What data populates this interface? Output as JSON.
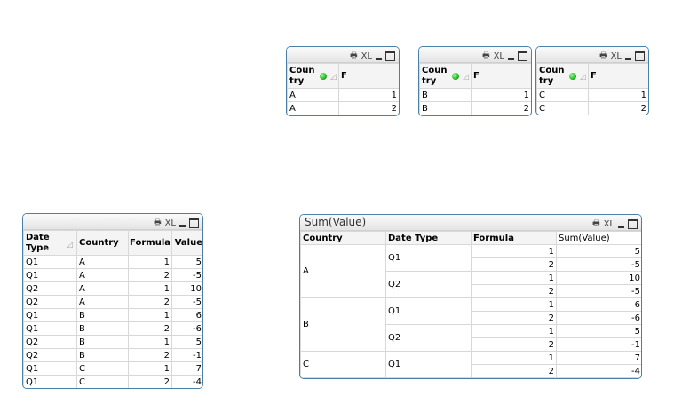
{
  "caption_icons": {
    "print": "print-icon",
    "xl": "XL",
    "minimize": "minimize-icon",
    "maximize": "maximize-icon"
  },
  "list_boxes": [
    {
      "header": [
        "Coun try",
        "F"
      ],
      "rows": [
        [
          "A",
          "1"
        ],
        [
          "A",
          "2"
        ]
      ]
    },
    {
      "header": [
        "Coun try",
        "F"
      ],
      "rows": [
        [
          "B",
          "1"
        ],
        [
          "B",
          "2"
        ]
      ]
    },
    {
      "header": [
        "Coun try",
        "F"
      ],
      "rows": [
        [
          "C",
          "1"
        ],
        [
          "C",
          "2"
        ]
      ]
    }
  ],
  "straight_table": {
    "header": [
      "Date Type",
      "Country",
      "Formula",
      "Value"
    ],
    "rows": [
      [
        "Q1",
        "A",
        "1",
        "5"
      ],
      [
        "Q1",
        "A",
        "2",
        "-5"
      ],
      [
        "Q2",
        "A",
        "1",
        "10"
      ],
      [
        "Q2",
        "A",
        "2",
        "-5"
      ],
      [
        "Q1",
        "B",
        "1",
        "6"
      ],
      [
        "Q1",
        "B",
        "2",
        "-6"
      ],
      [
        "Q2",
        "B",
        "1",
        "5"
      ],
      [
        "Q2",
        "B",
        "2",
        "-1"
      ],
      [
        "Q1",
        "C",
        "1",
        "7"
      ],
      [
        "Q1",
        "C",
        "2",
        "-4"
      ]
    ]
  },
  "pivot": {
    "title": "Sum(Value)",
    "header": [
      "Country",
      "Date Type",
      "Formula",
      "Sum(Value)"
    ],
    "groups": [
      {
        "country": "A",
        "dates": [
          {
            "date": "Q1",
            "rows": [
              [
                "1",
                "5"
              ],
              [
                "2",
                "-5"
              ]
            ]
          },
          {
            "date": "Q2",
            "rows": [
              [
                "1",
                "10"
              ],
              [
                "2",
                "-5"
              ]
            ]
          }
        ]
      },
      {
        "country": "B",
        "dates": [
          {
            "date": "Q1",
            "rows": [
              [
                "1",
                "6"
              ],
              [
                "2",
                "-6"
              ]
            ]
          },
          {
            "date": "Q2",
            "rows": [
              [
                "1",
                "5"
              ],
              [
                "2",
                "-1"
              ]
            ]
          }
        ]
      },
      {
        "country": "C",
        "dates": [
          {
            "date": "Q1",
            "rows": [
              [
                "1",
                "7"
              ],
              [
                "2",
                "-4"
              ]
            ]
          }
        ]
      }
    ]
  }
}
